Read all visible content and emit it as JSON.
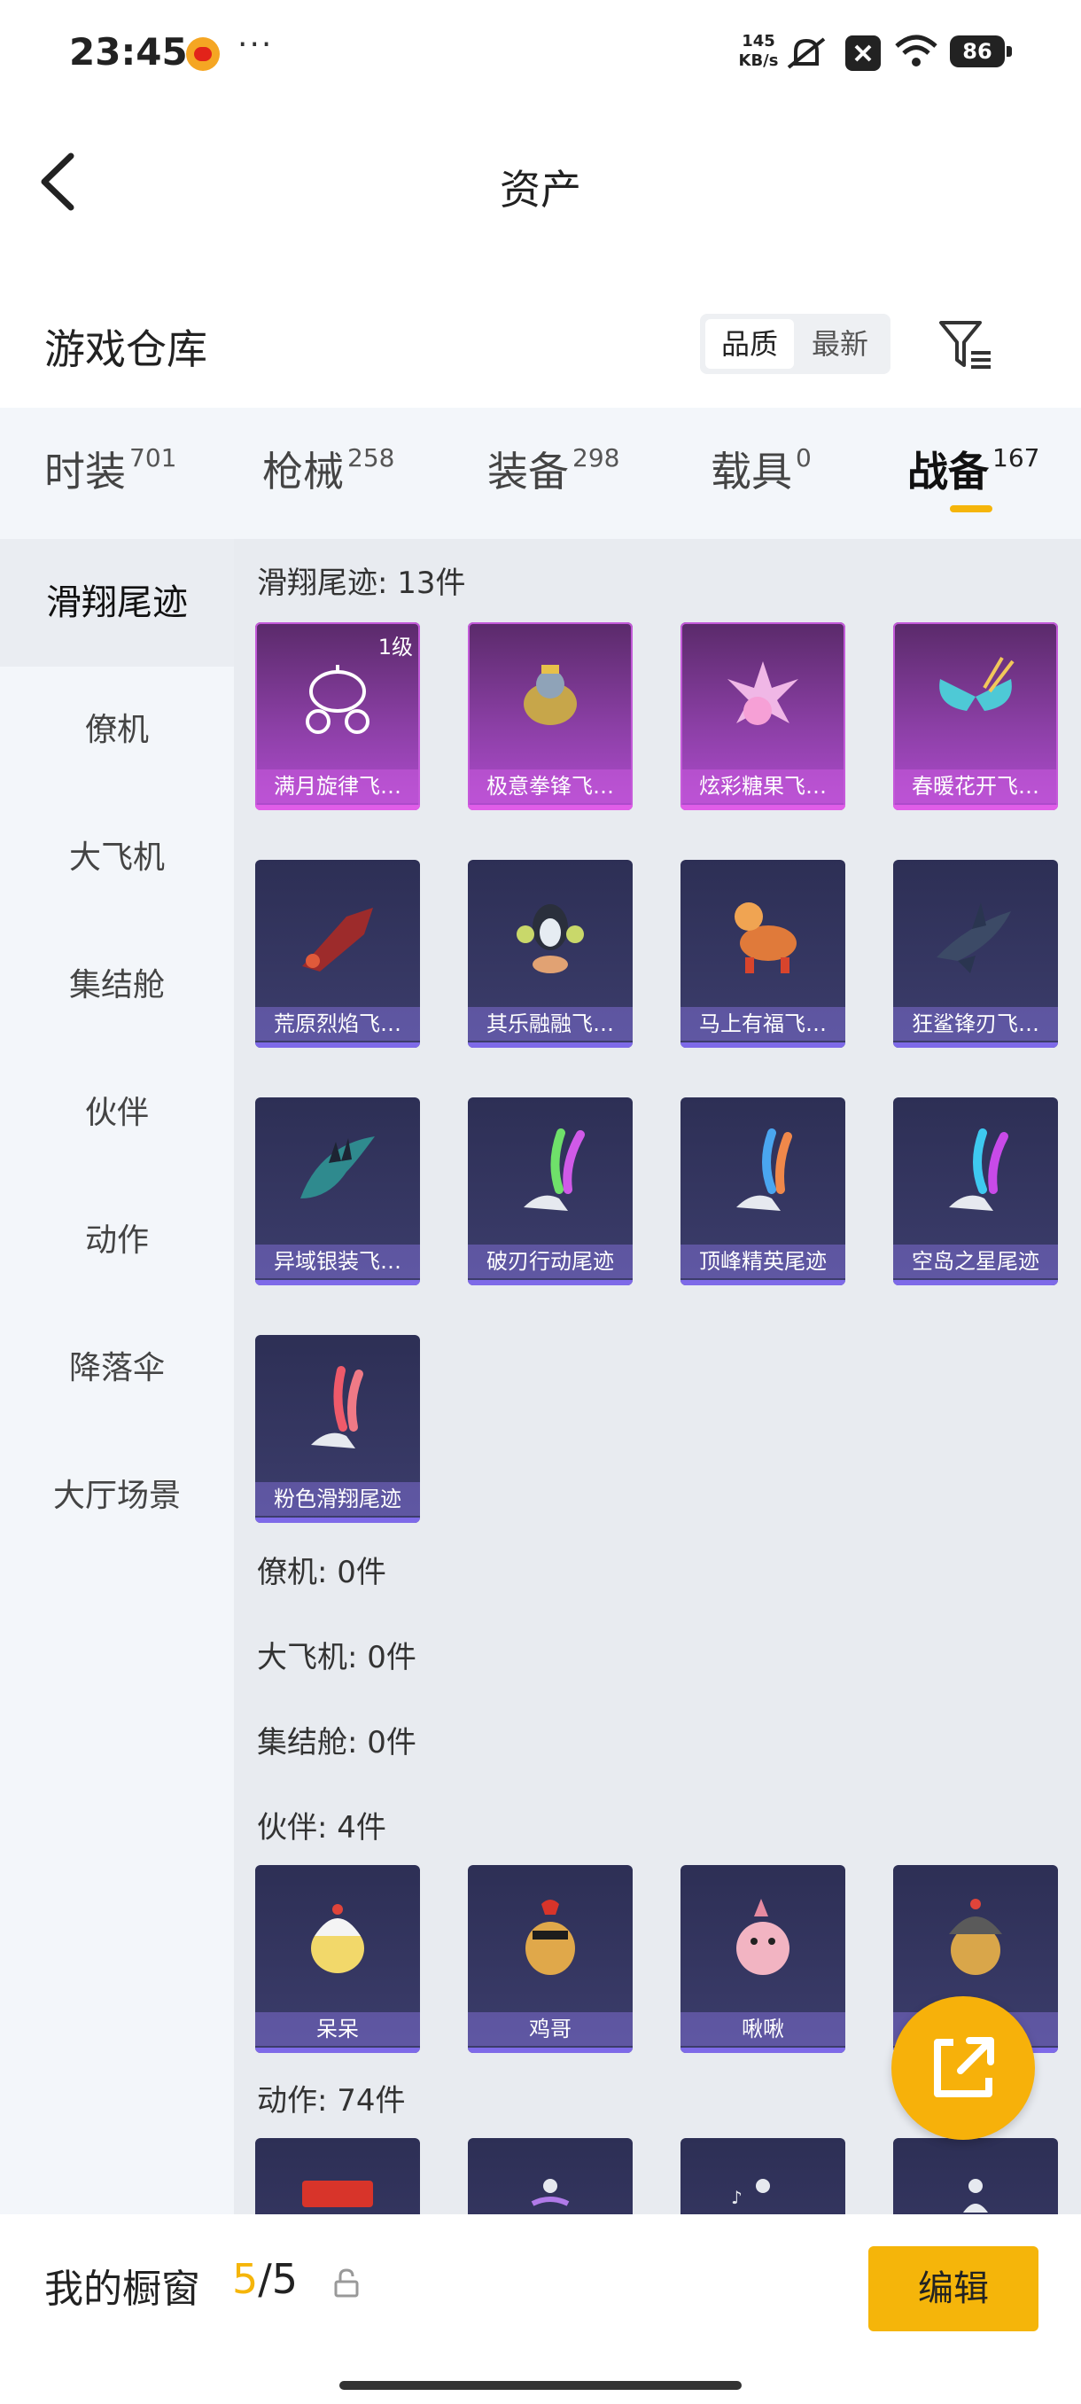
{
  "status_bar": {
    "time": "23:45",
    "more": "···",
    "net_speed_value": "145",
    "net_speed_unit": "KB/s",
    "battery": "86"
  },
  "header": {
    "title": "资产"
  },
  "section": {
    "title": "游戏仓库",
    "sort_options": [
      "品质",
      "最新"
    ]
  },
  "tabs": [
    {
      "label": "时装",
      "count": "701"
    },
    {
      "label": "枪械",
      "count": "258"
    },
    {
      "label": "装备",
      "count": "298"
    },
    {
      "label": "载具",
      "count": "0"
    },
    {
      "label": "战备",
      "count": "167"
    }
  ],
  "sidebar": {
    "items": [
      "滑翔尾迹",
      "僚机",
      "大飞机",
      "集结舱",
      "伙伴",
      "动作",
      "降落伞",
      "大厅场景"
    ]
  },
  "content": {
    "groups": [
      {
        "label": "滑翔尾迹: 13件"
      },
      {
        "label": "僚机: 0件"
      },
      {
        "label": "大飞机: 0件"
      },
      {
        "label": "集结舱: 0件"
      },
      {
        "label": "伙伴: 4件"
      },
      {
        "label": "动作: 74件"
      }
    ],
    "glide_items": [
      "满月旋律飞…",
      "极意拳锋飞…",
      "炫彩糖果飞…",
      "春暖花开飞…",
      "荒原烈焰飞…",
      "其乐融融飞…",
      "马上有福飞…",
      "狂鲨锋刃飞…",
      "异域银装飞…",
      "破刃行动尾迹",
      "顶峰精英尾迹",
      "空岛之星尾迹",
      "粉色滑翔尾迹"
    ],
    "level_badge": "1级",
    "partner_items": [
      "呆呆",
      "鸡哥",
      "啾啾",
      ""
    ]
  },
  "showcase": {
    "label": "我的橱窗",
    "current": "5",
    "separator": "/",
    "total": "5",
    "edit_label": "编辑"
  },
  "colors": {
    "accent": "#f5b50a",
    "rare_purple": "#b04ccf",
    "card_dark": "#2d2f55"
  }
}
